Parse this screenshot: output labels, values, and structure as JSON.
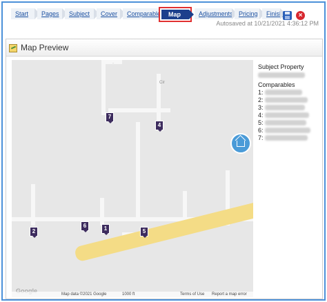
{
  "wizard": {
    "steps": [
      {
        "label": "Start"
      },
      {
        "label": "Pages"
      },
      {
        "label": "Subject"
      },
      {
        "label": "Cover"
      },
      {
        "label": "Comparables"
      },
      {
        "label": "Map"
      },
      {
        "label": "Adjustments"
      },
      {
        "label": "Pricing"
      },
      {
        "label": "Finish"
      }
    ],
    "active_step": "Map",
    "autosaved": "Autosaved at 10/21/2021 4:36:12 PM"
  },
  "panel": {
    "title": "Map Preview"
  },
  "map": {
    "subject_marker": "subject-home-icon",
    "comparable_markers": [
      {
        "label": "7"
      },
      {
        "label": "4"
      },
      {
        "label": "2"
      },
      {
        "label": "6"
      },
      {
        "label": "1"
      },
      {
        "label": "5"
      }
    ],
    "footer": {
      "map_data": "Map data ©2021 Google",
      "scale": "1000 ft",
      "terms": "Terms of Use",
      "report": "Report a map error"
    },
    "google_logo": "Google",
    "colors": {
      "subject_pin": "#4a9bd8",
      "comparable_pin": "#3d2c5e",
      "highlight_road": "#f4dc86"
    }
  },
  "sidebar": {
    "subject_heading": "Subject Property",
    "comparables_heading": "Comparables",
    "comparable_numbers": [
      "1:",
      "2:",
      "3:",
      "4:",
      "5:",
      "6:",
      "7:"
    ]
  },
  "colors": {
    "active_step_bg": "#1c3f8c",
    "active_step_outline": "#e03030",
    "frame_border": "#4a90d9"
  }
}
